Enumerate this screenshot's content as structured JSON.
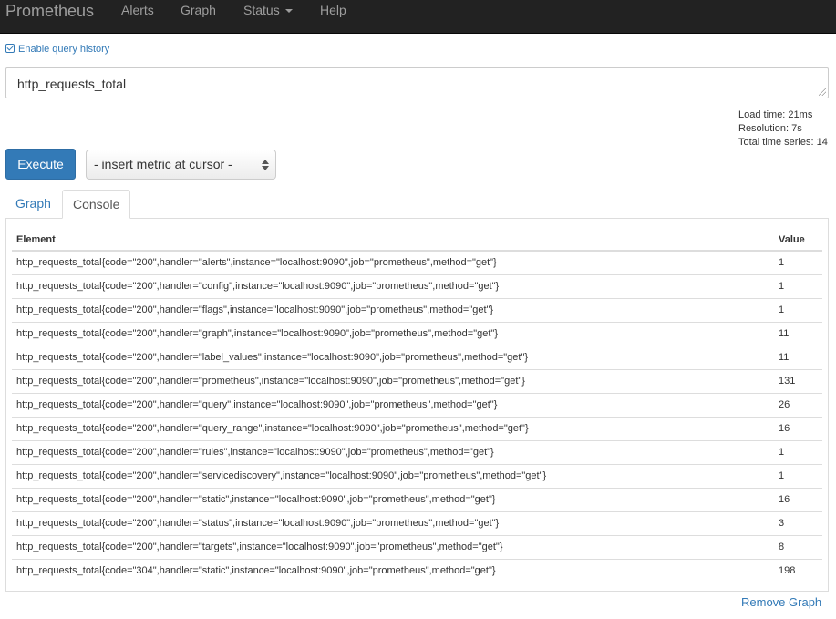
{
  "nav": {
    "brand": "Prometheus",
    "items": [
      "Alerts",
      "Graph",
      "Status",
      "Help"
    ]
  },
  "history": {
    "label": "Enable query history",
    "checked": true
  },
  "expression": {
    "value": "http_requests_total"
  },
  "stats": {
    "load_time": "Load time: 21ms",
    "resolution": "Resolution: 7s",
    "total_series": "Total time series: 14"
  },
  "execute_label": "Execute",
  "metric_select": {
    "selected": "- insert metric at cursor -"
  },
  "tabs": {
    "graph": "Graph",
    "console": "Console",
    "active": "Console"
  },
  "table": {
    "headers": {
      "element": "Element",
      "value": "Value"
    },
    "rows": [
      {
        "element": "http_requests_total{code=\"200\",handler=\"alerts\",instance=\"localhost:9090\",job=\"prometheus\",method=\"get\"}",
        "value": "1"
      },
      {
        "element": "http_requests_total{code=\"200\",handler=\"config\",instance=\"localhost:9090\",job=\"prometheus\",method=\"get\"}",
        "value": "1"
      },
      {
        "element": "http_requests_total{code=\"200\",handler=\"flags\",instance=\"localhost:9090\",job=\"prometheus\",method=\"get\"}",
        "value": "1"
      },
      {
        "element": "http_requests_total{code=\"200\",handler=\"graph\",instance=\"localhost:9090\",job=\"prometheus\",method=\"get\"}",
        "value": "11"
      },
      {
        "element": "http_requests_total{code=\"200\",handler=\"label_values\",instance=\"localhost:9090\",job=\"prometheus\",method=\"get\"}",
        "value": "11"
      },
      {
        "element": "http_requests_total{code=\"200\",handler=\"prometheus\",instance=\"localhost:9090\",job=\"prometheus\",method=\"get\"}",
        "value": "131"
      },
      {
        "element": "http_requests_total{code=\"200\",handler=\"query\",instance=\"localhost:9090\",job=\"prometheus\",method=\"get\"}",
        "value": "26"
      },
      {
        "element": "http_requests_total{code=\"200\",handler=\"query_range\",instance=\"localhost:9090\",job=\"prometheus\",method=\"get\"}",
        "value": "16"
      },
      {
        "element": "http_requests_total{code=\"200\",handler=\"rules\",instance=\"localhost:9090\",job=\"prometheus\",method=\"get\"}",
        "value": "1"
      },
      {
        "element": "http_requests_total{code=\"200\",handler=\"servicediscovery\",instance=\"localhost:9090\",job=\"prometheus\",method=\"get\"}",
        "value": "1"
      },
      {
        "element": "http_requests_total{code=\"200\",handler=\"static\",instance=\"localhost:9090\",job=\"prometheus\",method=\"get\"}",
        "value": "16"
      },
      {
        "element": "http_requests_total{code=\"200\",handler=\"status\",instance=\"localhost:9090\",job=\"prometheus\",method=\"get\"}",
        "value": "3"
      },
      {
        "element": "http_requests_total{code=\"200\",handler=\"targets\",instance=\"localhost:9090\",job=\"prometheus\",method=\"get\"}",
        "value": "8"
      },
      {
        "element": "http_requests_total{code=\"304\",handler=\"static\",instance=\"localhost:9090\",job=\"prometheus\",method=\"get\"}",
        "value": "198"
      }
    ]
  },
  "remove_graph": "Remove Graph",
  "colors": {
    "navbar": "#222222",
    "primary": "#337ab7",
    "border": "#dddddd"
  }
}
